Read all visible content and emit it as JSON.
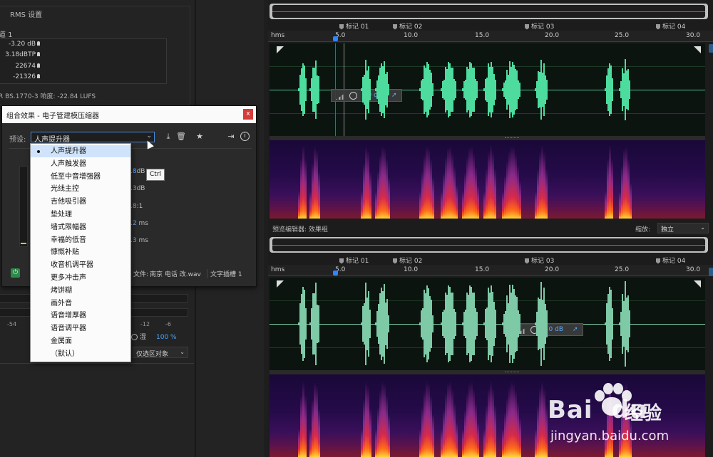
{
  "left": {
    "rms_title": "RMS 设置",
    "subtitle": "道 1",
    "rows": [
      {
        "value": "-3.20 dB"
      },
      {
        "value": "3.18dBTP"
      },
      {
        "value": "22674"
      },
      {
        "value": "-21326"
      }
    ],
    "bs_text": "R BS.1770-3 响度: -22.84 LUFS",
    "ticks": [
      "-54",
      "-12",
      "-6"
    ],
    "mix_label": "湿",
    "mix_value": "100 %",
    "scope_select": "仅选区对象"
  },
  "dialog": {
    "title": "组合效果 - 电子管建模压缩器",
    "close": "x",
    "preset_label": "预设:",
    "preset_value": "人声提升器",
    "params": [
      {
        "value": ".8",
        "unit": "dB"
      },
      {
        "value": ".3",
        "unit": "dB"
      },
      {
        "value": ".8",
        "unit": ":1"
      },
      {
        "value": ".2",
        "unit": " ms"
      },
      {
        "value": ".3",
        "unit": " ms"
      }
    ],
    "file_label": "文件:",
    "file_name": "南京 电话 改.wav",
    "insert_label": "文字插槽 1"
  },
  "dropdown": {
    "items": [
      "人声提升器",
      "人声触发器",
      "低至中音增强器",
      "光线主控",
      "吉他吸引器",
      "垫处理",
      "墙式限幅器",
      "幸福的低音",
      "慷慨补贴",
      "收音机调平器",
      "更多冲击声",
      "烤饼糊",
      "画外音",
      "语音增厚器",
      "语音调平器",
      "金属面",
      "（默认）"
    ],
    "selected_index": 0
  },
  "tooltip": "Ctrl",
  "editor": {
    "markers": [
      "标记 01",
      "标记 02",
      "标记 03",
      "标记 04"
    ],
    "ruler": [
      "hms",
      "5.0",
      "10.0",
      "15.0",
      "20.0",
      "25.0",
      "30.0"
    ],
    "hud_value": "+0 dB",
    "preview_label": "预览编辑器: 效果组",
    "zoom_label": "缩放:",
    "zoom_value": "独立",
    "colors": {
      "wave_top": "#4ddc9e",
      "wave_bottom": "#7ec9a6",
      "playhead": "#d03030",
      "accent": "#2f86ff"
    }
  },
  "watermark": {
    "brand": "Bai",
    "brand2": "du",
    "cn": "经验",
    "url": "jingyan.baidu.com"
  }
}
